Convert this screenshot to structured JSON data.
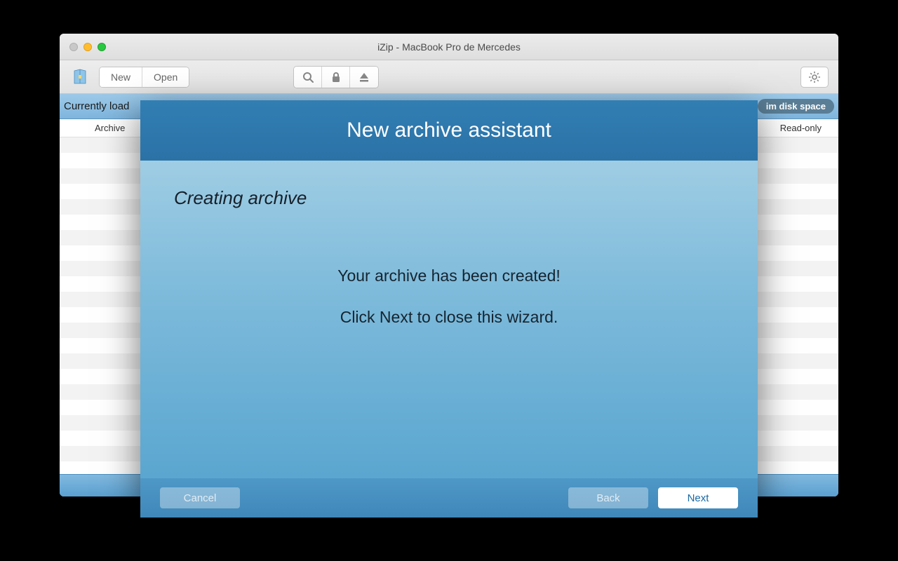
{
  "window": {
    "title": "iZip - MacBook Pro de Mercedes"
  },
  "toolbar": {
    "new_label": "New",
    "open_label": "Open"
  },
  "status": {
    "text": "Currently load",
    "pill_label": "im disk space"
  },
  "table": {
    "columns": {
      "archive": "Archive",
      "readonly": "Read-only"
    }
  },
  "assistant": {
    "title": "New archive assistant",
    "subtitle": "Creating archive",
    "message_1": "Your archive has been created!",
    "message_2": "Click Next to close this wizard.",
    "buttons": {
      "cancel": "Cancel",
      "back": "Back",
      "next": "Next"
    }
  }
}
